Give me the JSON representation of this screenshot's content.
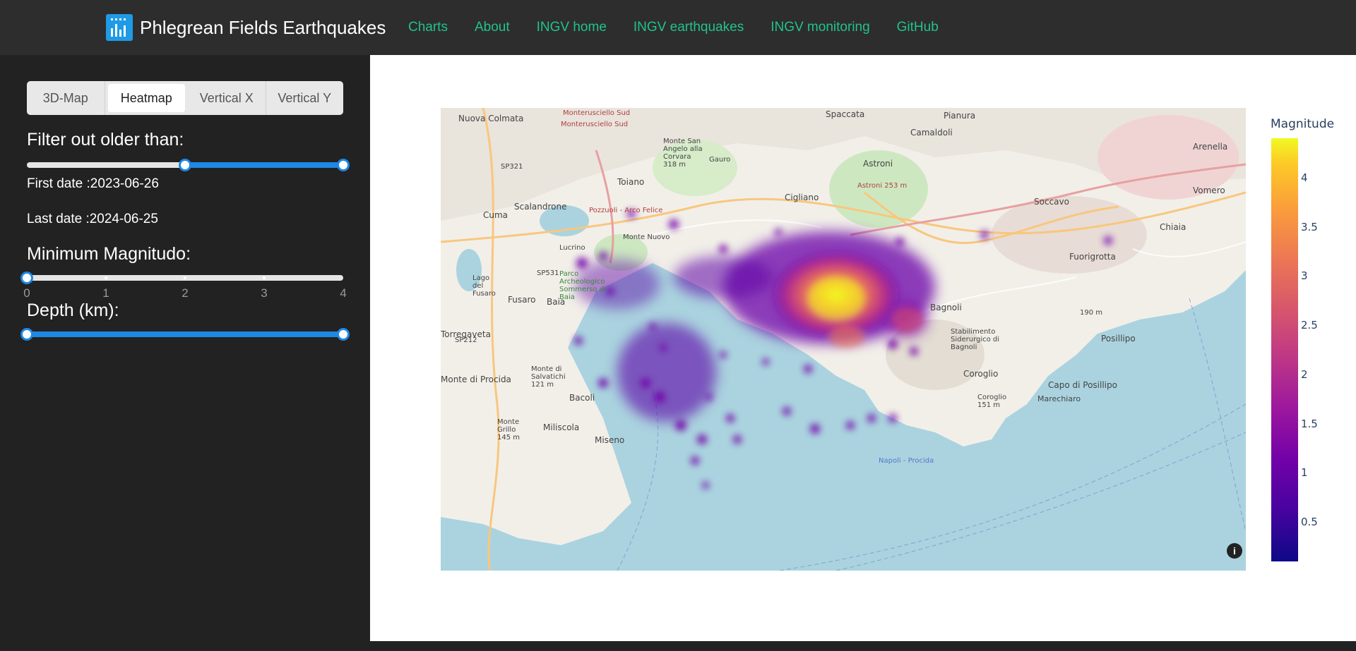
{
  "navbar": {
    "title": "Phlegrean Fields Earthquakes",
    "links": [
      "Charts",
      "About",
      "INGV home",
      "INGV earthquakes",
      "INGV monitoring",
      "GitHub"
    ],
    "link_color": "#22c28a"
  },
  "sidebar": {
    "tabs": [
      "3D-Map",
      "Heatmap",
      "Vertical X",
      "Vertical Y"
    ],
    "active_tab": "Heatmap",
    "filter_label": "Filter out older than:",
    "date_slider_range": [
      0.5,
      1.0
    ],
    "first_date": "First date :2023-06-26",
    "last_date": "Last date :2024-06-25",
    "magnitude_label": "Minimum Magnitudo:",
    "magnitude_ticks": [
      "0",
      "1",
      "2",
      "3",
      "4"
    ],
    "magnitude_value": 0,
    "depth_label": "Depth (km):",
    "depth_range": [
      0.0,
      1.0
    ],
    "accent": "#1e88e5"
  },
  "map": {
    "labels": [
      "Nuova Colmata",
      "Monterusciello Sud",
      "Spaccata",
      "Pianura",
      "Camaldoli",
      "Arenella",
      "Vomero",
      "Toiano",
      "Monte San Angelo alla Corvara 318 m",
      "Gauro",
      "Astroni",
      "Astroni 253 m",
      "Cigliano",
      "Scalandrone",
      "Cuma",
      "Soccavo",
      "Chiaia",
      "Fuorigrotta",
      "Lucrino",
      "Monte Nuovo",
      "Parco Archeologico Sommerso di Baia",
      "Lago del Fusaro",
      "Fusaro",
      "Baia",
      "Bagnoli",
      "Torregaveta",
      "Monte di Procida",
      "Monte di Salvatichi 121 m",
      "Bacoli",
      "Monte Grillo 145 m",
      "Miliscola",
      "Miseno",
      "Coroglio",
      "Capo di Posillipo",
      "Posillipo",
      "Marechiaro",
      "Coroglio 151 m",
      "Stabilimento Siderurgico di Bagnoli",
      "190 m",
      "Napoli - Procida",
      "SP321",
      "SP531",
      "SP212",
      "Monterusciello Sud",
      "Pozzuoli - Arco Felice"
    ],
    "info_icon": "info-icon"
  },
  "colorbar": {
    "title": "Magnitude",
    "ticks": [
      "4",
      "3.5",
      "3",
      "2.5",
      "2",
      "1.5",
      "1",
      "0.5"
    ],
    "tick_values": [
      4,
      3.5,
      3,
      2.5,
      2,
      1.5,
      1,
      0.5
    ],
    "range": [
      0.1,
      4.4
    ],
    "colorscale": "plasma"
  }
}
